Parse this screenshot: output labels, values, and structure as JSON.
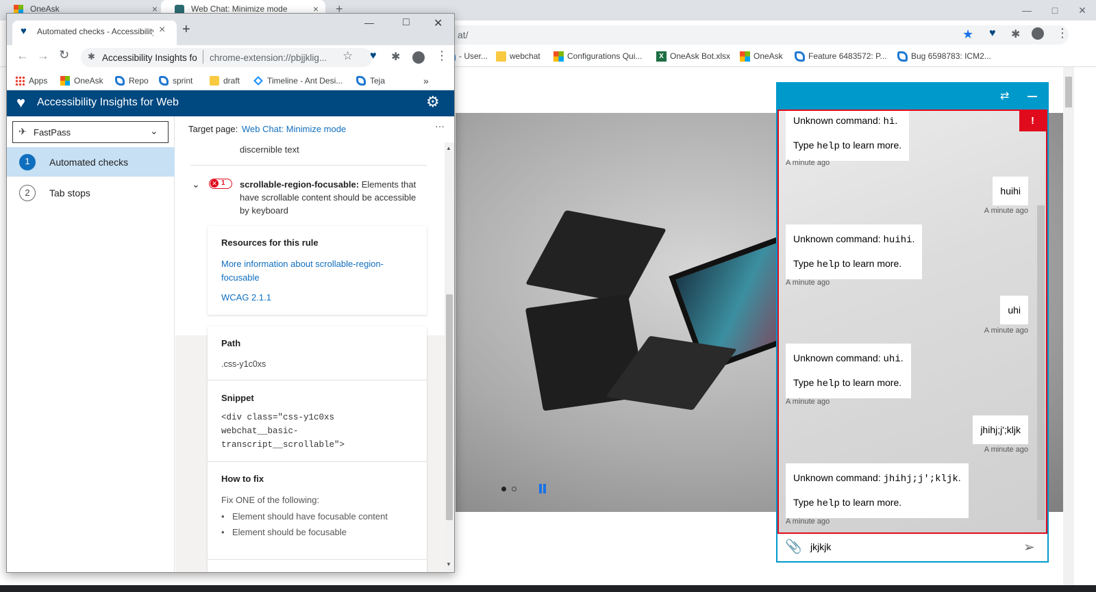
{
  "bg_browser": {
    "tabs": [
      {
        "title": "OneAsk",
        "close": "×"
      },
      {
        "title": "Web Chat: Minimize mode",
        "close": "×"
      }
    ],
    "new_tab": "+",
    "url_tail": "at/",
    "window_controls": {
      "minimize": "—",
      "maximize": "□",
      "close": "✕"
    },
    "bookmarks": [
      {
        "label": "- User...",
        "icon": "ado-icon"
      },
      {
        "label": "webchat",
        "icon": "folder-icon"
      },
      {
        "label": "Configurations Qui...",
        "icon": "microsoft-icon"
      },
      {
        "label": "OneAsk Bot.xlsx",
        "icon": "excel-icon"
      },
      {
        "label": "OneAsk",
        "icon": "microsoft-icon"
      },
      {
        "label": "Feature 6483572: P...",
        "icon": "ado-icon"
      },
      {
        "label": "Bug 6598783: ICM2...",
        "icon": "ado-icon"
      }
    ]
  },
  "popup": {
    "tab_title": "Automated checks - Accessibility",
    "tab_close": "×",
    "new_tab": "+",
    "window_controls": {
      "minimize": "—",
      "maximize": "□",
      "close": "✕"
    },
    "omnibox": {
      "site": "Accessibility Insights fo",
      "url": "chrome-extension://pbjjklig..."
    },
    "bookmarks": [
      {
        "label": "Apps",
        "icon": "apps-icon"
      },
      {
        "label": "OneAsk",
        "icon": "microsoft-icon"
      },
      {
        "label": "Repo",
        "icon": "ado-icon"
      },
      {
        "label": "sprint",
        "icon": "ado-icon"
      },
      {
        "label": "draft",
        "icon": "folder-icon"
      },
      {
        "label": "Timeline - Ant Desi...",
        "icon": "ant-design-icon"
      },
      {
        "label": "Teja",
        "icon": "ado-icon"
      }
    ],
    "bookmarks_overflow": "»"
  },
  "insights": {
    "title": "Accessibility Insights for Web",
    "mode": "FastPass",
    "nav": [
      {
        "num": "1",
        "label": "Automated checks",
        "selected": true
      },
      {
        "num": "2",
        "label": "Tab stops",
        "selected": false
      }
    ],
    "target_label": "Target page:",
    "target_link": "Web Chat: Minimize mode",
    "more": "···",
    "prev_rule_tail": "discernible text",
    "rule": {
      "name": "scrollable-region-focusable:",
      "desc": "Elements that have scrollable content should be accessible by keyboard",
      "fail_count": "1"
    },
    "resources": {
      "heading": "Resources for this rule",
      "more_info": "More information about scrollable-region-focusable",
      "wcag": "WCAG 2.1.1"
    },
    "path": {
      "heading": "Path",
      "value": ".css-y1c0xs"
    },
    "snippet": {
      "heading": "Snippet",
      "lines": [
        "<div class=\"css-y1c0xs",
        "webchat__basic-",
        "transcript__scrollable\">"
      ]
    },
    "fix": {
      "heading": "How to fix",
      "intro": "Fix ONE of the following:",
      "items": [
        "Element should have focusable content",
        "Element should be focusable"
      ]
    }
  },
  "chat": {
    "messages": [
      {
        "from": "bot",
        "prefix": "Unknown command: ",
        "cmd": "hi",
        "suffix": ".",
        "help_pre": "Type ",
        "help_cmd": "help",
        "help_post": " to learn more.",
        "time": "A minute ago"
      },
      {
        "from": "user",
        "text": "huihi",
        "time": "A minute ago"
      },
      {
        "from": "bot",
        "prefix": "Unknown command: ",
        "cmd": "huihi",
        "suffix": ".",
        "help_pre": "Type ",
        "help_cmd": "help",
        "help_post": " to learn more.",
        "time": "A minute ago"
      },
      {
        "from": "user",
        "text": "uhi",
        "time": "A minute ago"
      },
      {
        "from": "bot",
        "prefix": "Unknown command: ",
        "cmd": "uhi",
        "suffix": ".",
        "help_pre": "Type ",
        "help_cmd": "help",
        "help_post": " to learn more.",
        "time": "A minute ago"
      },
      {
        "from": "user",
        "text": "jhihj;j';kljk",
        "time": "A minute ago"
      },
      {
        "from": "bot",
        "prefix": "Unknown command: ",
        "cmd": "jhihj;j';kljk",
        "suffix": ".",
        "help_pre": "Type ",
        "help_cmd": "help",
        "help_post": " to learn more.",
        "time": "A minute ago"
      }
    ],
    "input_value": "jkjkjk",
    "error_badge": "!",
    "accent": "#0099cc",
    "error_color": "#e00b1c"
  }
}
